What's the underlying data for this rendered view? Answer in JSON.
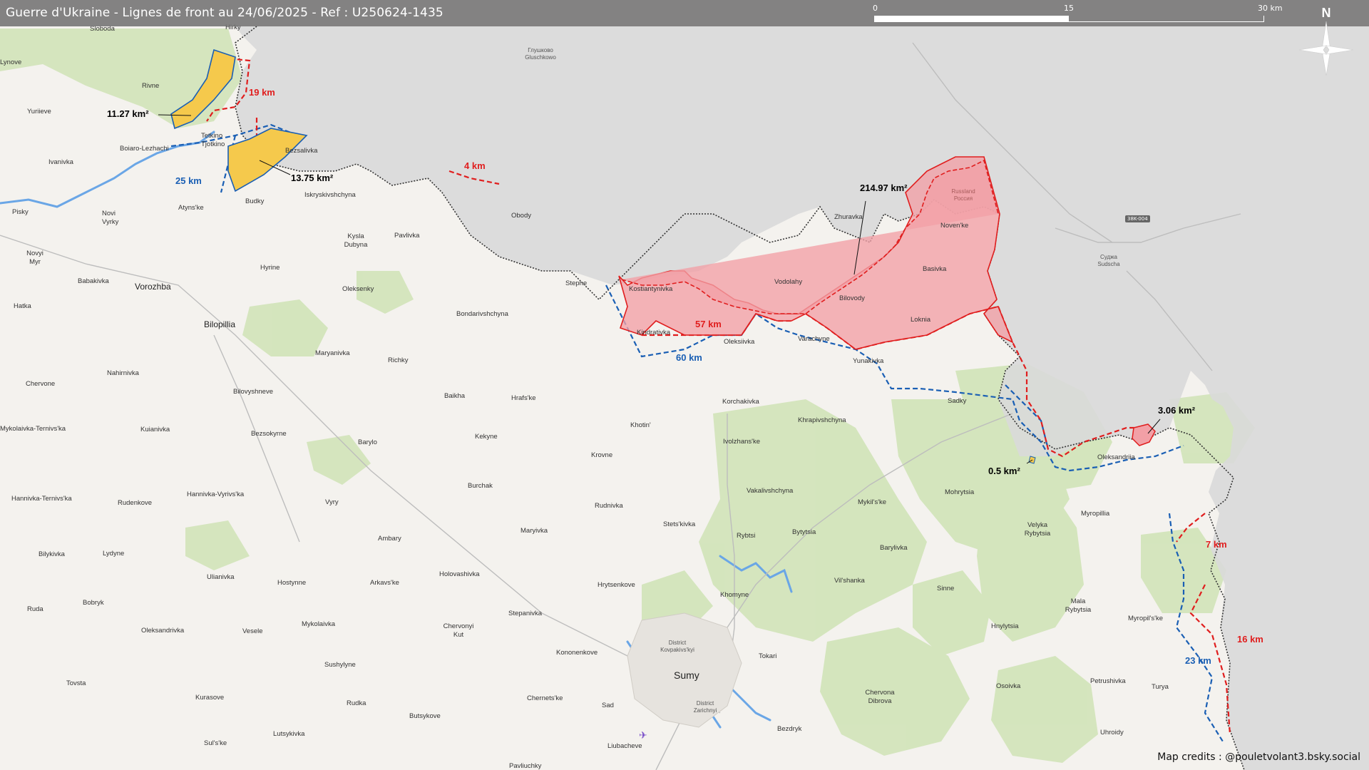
{
  "title": "Guerre d'Ukraine - Lignes de front au 24/06/2025 - Ref : U250624-1435",
  "scale": {
    "l0": "0",
    "l1": "15",
    "l2": "30 km"
  },
  "north_label": "N",
  "credits": "Map credits : @pouletvolant3.bsky.social",
  "colors": {
    "russia_zone": "#d9d9d9",
    "red_line": "#e01e1e",
    "blue_line": "#1a5fb4",
    "red_area": "#f2a0a6",
    "yellow_area": "#f5c94c",
    "forest": "#cfe3b5"
  },
  "icons": {
    "north": "compass-rose-icon",
    "airport": "airplane-icon"
  },
  "areas": {
    "a1": "11.27 km²",
    "a2": "13.75 km²",
    "a3": "214.97 km²",
    "a4": "3.06 km²",
    "a5": "0.5 km²"
  },
  "distances": {
    "d1": "19 km",
    "d2": "25 km",
    "d3": "4 km",
    "d4": "57 km",
    "d5": "60 km",
    "d6": "7 km",
    "d7": "16 km",
    "d8": "23 km"
  },
  "road_badge": "38K-004",
  "places": {
    "p1": "Sloboda",
    "p2": "Hirky",
    "p3": "Lynove",
    "p4": "Rivne",
    "p5": "Yuriieve",
    "p6": "Tetkino",
    "p7": "Tjotkino",
    "p8": "Boiaro-Lezhachi",
    "p9": "Bezsalivka",
    "p10": "Ivanivka",
    "p11": "Budky",
    "p12": "Iskryskivshchyna",
    "p13": "Atyns'ke",
    "p14": "Novi Vyrky",
    "p15": "Pisky",
    "p16": "Obody",
    "p17": "Kysla Dubyna",
    "p18": "Pavlivka",
    "p19": "Novyi Myr",
    "p20": "Hyrine",
    "p21": "Babakivka",
    "p22": "Vorozhba",
    "p23": "Oleksenky",
    "p24": "Stepne",
    "p25": "Hatka",
    "p26": "Bondarivshchyna",
    "p27": "Bilopillia",
    "p28": "Maryanivka",
    "p29": "Richky",
    "p30": "Nahirnivka",
    "p31": "Chervone",
    "p32": "Bilovyshneve",
    "p33": "Baikha",
    "p34": "Hrafs'ke",
    "p35": "Mykolaivka-Ternivs'ka",
    "p36": "Kuianivka",
    "p37": "Bezsokyrne",
    "p38": "Barylo",
    "p39": "Kekyne",
    "p40": "Khotin'",
    "p41": "Korchakivka",
    "p42": "Khrapivshchyna",
    "p43": "Ivolzhans'ke",
    "p44": "Krovne",
    "p45": "Burchak",
    "p46": "Hannivka-Ternivs'ka",
    "p47": "Rudenkove",
    "p48": "Hannivka-Vyrivs'ka",
    "p49": "Vyry",
    "p50": "Rudnivka",
    "p51": "Vakalivshchyna",
    "p52": "Bilykivka",
    "p53": "Lydyne",
    "p54": "Ambary",
    "p55": "Maryivka",
    "p56": "Stets'kivka",
    "p57": "Rybtsi",
    "p58": "Bytytsia",
    "p59": "Ulianivka",
    "p60": "Hostynne",
    "p61": "Arkavs'ke",
    "p62": "Holovashivka",
    "p63": "Hrytsenkove",
    "p64": "Khomyne",
    "p65": "Ruda",
    "p66": "Bobryk",
    "p67": "Oleksandrivka",
    "p68": "Vesele",
    "p69": "Mykolaivka",
    "p70": "Chervonyi Kut",
    "p71": "Stepanivka",
    "p72": "Kononenkove",
    "p73": "District Kovpakivs'kyi",
    "p74": "Sumy",
    "p75": "Tokari",
    "p76": "Sushylyne",
    "p77": "Tovsta",
    "p78": "Kurasove",
    "p79": "Rudka",
    "p80": "Chernets'ke",
    "p81": "Sad",
    "p82": "District Zarichnyi",
    "p83": "Butsykove",
    "p84": "Lutsykivka",
    "p85": "Sul's'ke",
    "p86": "Liubacheve",
    "p87": "Pavliuchky",
    "p88": "Bezdryk",
    "p89": "Kostiantynivka",
    "p90": "Kindrativka",
    "p91": "Oleksiivka",
    "p92": "Varachyne",
    "p93": "Yunakivka",
    "p94": "Zhuravka",
    "p95": "Vodolahy",
    "p96": "Bilovody",
    "p97": "Loknia",
    "p98": "Basivka",
    "p99": "Noven'ke",
    "p100": "Sadky",
    "p101": "Oleksandriia",
    "p102": "Mohrytsia",
    "p103": "Mykil's'ke",
    "p104": "Velyka Rybytsia",
    "p105": "Myropillia",
    "p106": "Barylivka",
    "p107": "Vil'shanka",
    "p108": "Sinne",
    "p109": "Mala Rybytsia",
    "p110": "Hnylytsia",
    "p111": "Myropil's'ke",
    "p112": "Chervona Dibrova",
    "p113": "Osoivka",
    "p114": "Petrushivka",
    "p115": "Turya",
    "p116": "Uhroidy",
    "p117": "Глушково Gluschkowo",
    "p118": "Суджа Sudscha",
    "p119": "Russland Россия"
  }
}
